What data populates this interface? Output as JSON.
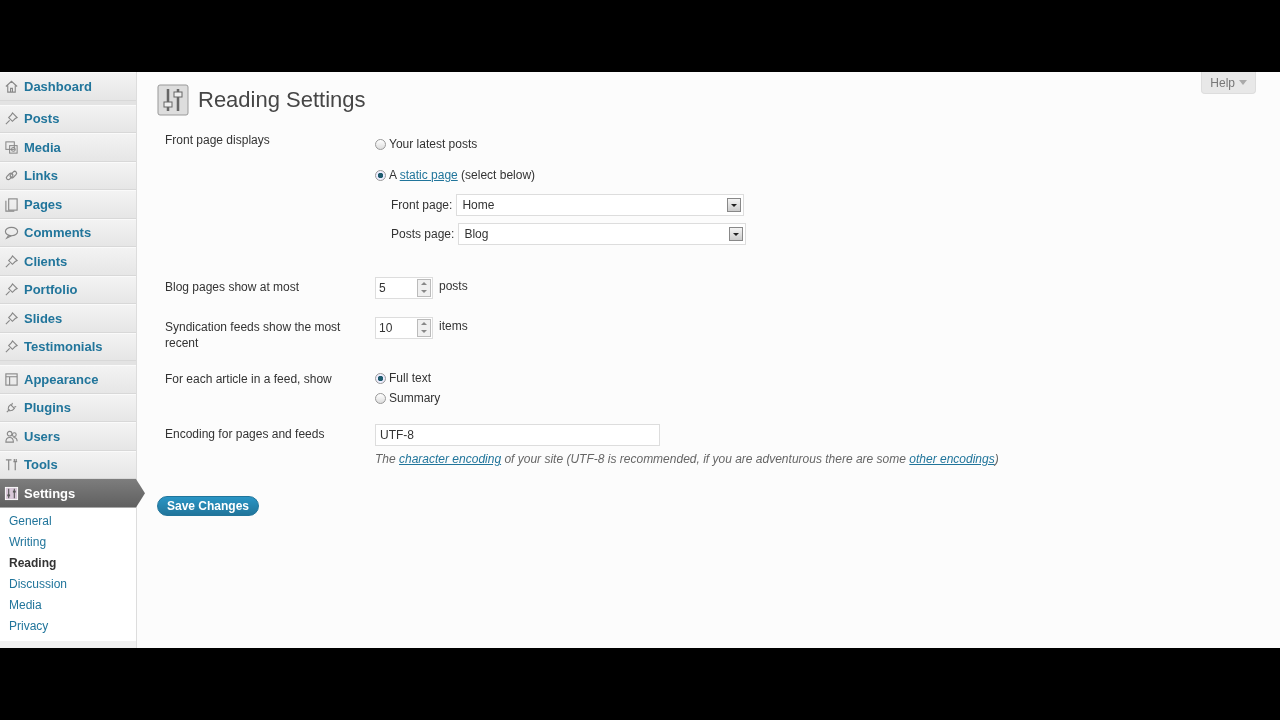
{
  "help_tab": {
    "label": "Help"
  },
  "sidebar": {
    "groups": [
      [
        {
          "label": "Dashboard",
          "kind": "house",
          "selected": false
        }
      ],
      [
        {
          "label": "Posts",
          "kind": "pin",
          "selected": false
        },
        {
          "label": "Media",
          "kind": "media",
          "selected": false
        },
        {
          "label": "Links",
          "kind": "chain",
          "selected": false
        },
        {
          "label": "Pages",
          "kind": "pages",
          "selected": false
        },
        {
          "label": "Comments",
          "kind": "bubble",
          "selected": false
        },
        {
          "label": "Clients",
          "kind": "pin",
          "selected": false
        },
        {
          "label": "Portfolio",
          "kind": "pin",
          "selected": false
        },
        {
          "label": "Slides",
          "kind": "pin",
          "selected": false
        },
        {
          "label": "Testimonials",
          "kind": "pin",
          "selected": false
        }
      ],
      [
        {
          "label": "Appearance",
          "kind": "window",
          "selected": false
        },
        {
          "label": "Plugins",
          "kind": "plug",
          "selected": false
        },
        {
          "label": "Users",
          "kind": "people",
          "selected": false
        },
        {
          "label": "Tools",
          "kind": "tools",
          "selected": false
        },
        {
          "label": "Settings",
          "kind": "sliders",
          "selected": true
        }
      ]
    ],
    "submenu": [
      {
        "label": "General",
        "selected": false
      },
      {
        "label": "Writing",
        "selected": false
      },
      {
        "label": "Reading",
        "selected": true
      },
      {
        "label": "Discussion",
        "selected": false
      },
      {
        "label": "Media",
        "selected": false
      },
      {
        "label": "Privacy",
        "selected": false
      }
    ]
  },
  "page": {
    "title": "Reading Settings"
  },
  "rows": [
    {
      "kind": "radios",
      "label": "Front page displays",
      "options": [
        {
          "parts": [
            {
              "text": "Your latest posts"
            }
          ],
          "selected": false
        },
        {
          "parts": [
            {
              "text": "A "
            },
            {
              "text": "static page",
              "link": true
            },
            {
              "text": " (select below)"
            }
          ],
          "selected": true
        }
      ],
      "selects": [
        {
          "label": "Front page:",
          "value": "Home"
        },
        {
          "label": "Posts page:",
          "value": "Blog"
        }
      ]
    },
    {
      "kind": "number",
      "label": "Blog pages show at most",
      "value": "5",
      "unit": "posts"
    },
    {
      "kind": "number",
      "label": "Syndication feeds show the most recent",
      "value": "10",
      "unit": "items"
    },
    {
      "kind": "radios",
      "label": "For each article in a feed, show",
      "options": [
        {
          "parts": [
            {
              "text": "Full text"
            }
          ],
          "selected": true
        },
        {
          "parts": [
            {
              "text": "Summary"
            }
          ],
          "selected": false
        }
      ]
    },
    {
      "kind": "text",
      "label": "Encoding for pages and feeds",
      "value": "UTF-8",
      "description": [
        {
          "text": "The "
        },
        {
          "text": "character encoding",
          "link": true
        },
        {
          "text": " of your site (UTF-8 is recommended, if you are adventurous there are some "
        },
        {
          "text": "other encodings",
          "link": true
        },
        {
          "text": ")"
        }
      ]
    }
  ],
  "save_button": "Save Changes"
}
